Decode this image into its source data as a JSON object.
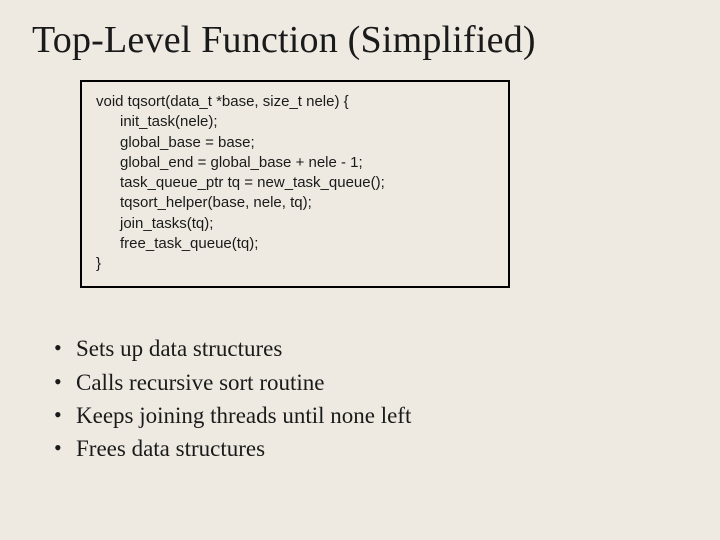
{
  "title": "Top-Level Function (Simplified)",
  "code": {
    "sig": "void tqsort(data_t *base, size_t nele) {",
    "l1": "init_task(nele);",
    "l2": "global_base = base;",
    "l3": "global_end = global_base + nele - 1;",
    "l4": "task_queue_ptr tq = new_task_queue();",
    "l5": "tqsort_helper(base, nele, tq);",
    "l6": "join_tasks(tq);",
    "l7": "free_task_queue(tq);",
    "close": "}"
  },
  "bullets": {
    "b1": "Sets up data structures",
    "b2": "Calls recursive sort routine",
    "b3": "Keeps joining threads until none left",
    "b4": "Frees data structures"
  }
}
